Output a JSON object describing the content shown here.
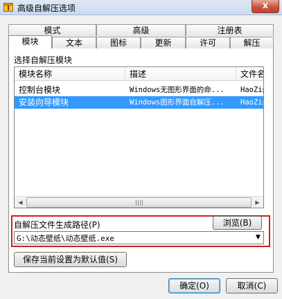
{
  "window": {
    "title": "高级自解压选项",
    "close_glyph": "x"
  },
  "tabs_row1": [
    "模式",
    "高级",
    "注册表"
  ],
  "tabs_row2": [
    "模块",
    "文本",
    "图标",
    "更新",
    "许可",
    "解压"
  ],
  "section_label": "选择自解压模块",
  "list": {
    "columns": [
      "模块名称",
      "描述",
      "文件名"
    ],
    "rows": [
      {
        "name": "控制台模块",
        "desc": "Windows无图形界面的命...",
        "file": "HaoZip",
        "selected": false
      },
      {
        "name": "安装向导模块",
        "desc": "Windows图形界面自解压...",
        "file": "HaoZip",
        "selected": true
      }
    ]
  },
  "path_section": {
    "label": "自解压文件生成路径(P)",
    "browse_label": "浏览(B)",
    "value": "G:\\动态壁纸\\动态壁纸.exe"
  },
  "save_default_label": "保存当前设置为默认值(S)",
  "ok_label": "确定(O)",
  "cancel_label": "取消(C)",
  "icons": {
    "app": "archive-icon",
    "dropdown": "chevron-down-icon",
    "scroll_left": "arrow-left-icon",
    "scroll_right": "arrow-right-icon"
  },
  "colors": {
    "selection": "#3399ff",
    "highlight_box": "#cc1f1f",
    "title_close": "#c7503a"
  }
}
